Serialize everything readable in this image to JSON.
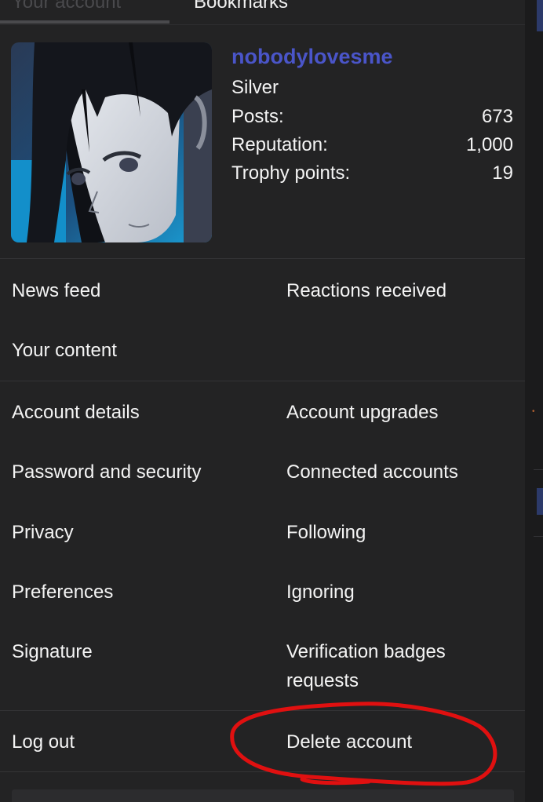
{
  "tabs": {
    "your_account": "Your account",
    "bookmarks": "Bookmarks"
  },
  "profile": {
    "username": "nobodylovesme",
    "rank": "Silver",
    "stats": [
      {
        "label": "Posts:",
        "value": "673"
      },
      {
        "label": "Reputation:",
        "value": "1,000"
      },
      {
        "label": "Trophy points:",
        "value": "19"
      }
    ]
  },
  "menu": {
    "section1": {
      "news_feed": "News feed",
      "reactions_received": "Reactions received",
      "your_content": "Your content"
    },
    "section2": {
      "account_details": "Account details",
      "account_upgrades": "Account upgrades",
      "password_and_security": "Password and security",
      "connected_accounts": "Connected accounts",
      "privacy": "Privacy",
      "following": "Following",
      "preferences": "Preferences",
      "ignoring": "Ignoring",
      "signature": "Signature",
      "verification_badges_line1": "Verification badges",
      "verification_badges_line2": "requests"
    },
    "section3": {
      "log_out": "Log out",
      "delete_account": "Delete account"
    }
  },
  "colors": {
    "background": "#232324",
    "username": "#4a55c9",
    "annotation": "#e01010"
  }
}
